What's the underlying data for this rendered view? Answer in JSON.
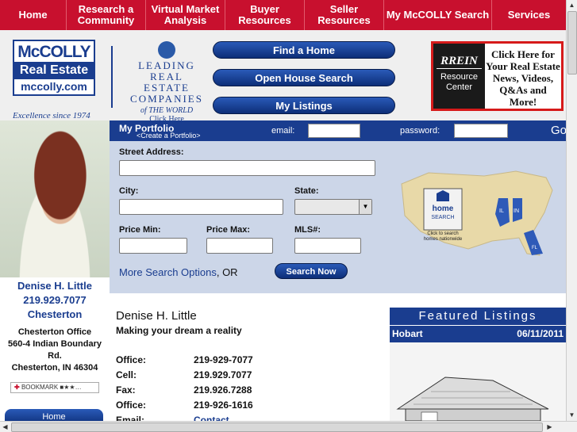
{
  "nav": {
    "home": "Home",
    "research": "Research a Community",
    "virtual": "Virtual Market Analysis",
    "buyer": "Buyer Resources",
    "seller": "Seller Resources",
    "mysearch": "My McCOLLY Search",
    "services": "Services"
  },
  "logo": {
    "brand": "McCOLLY",
    "sub": "Real Estate",
    "domain": "mccolly.com",
    "since": "Excellence since 1974"
  },
  "lrec": {
    "line1": "LEADING",
    "line2": "REAL ESTATE",
    "line3": "COMPANIES",
    "line4": "of THE WORLD",
    "click": "Click Here"
  },
  "quick": {
    "find": "Find a Home",
    "open": "Open House Search",
    "listings": "My Listings"
  },
  "rrein": {
    "logo": "RREIN",
    "sub": "Resource Center",
    "text": "Click Here for Your Real Estate News, Videos, Q&As and More!"
  },
  "portfolio": {
    "title": "My Portfolio",
    "create": "<Create a Portfolio>",
    "email_label": "email:",
    "password_label": "password:",
    "go": "Go"
  },
  "search": {
    "street_label": "Street Address:",
    "city_label": "City:",
    "state_label": "State:",
    "price_min_label": "Price Min:",
    "price_max_label": "Price Max:",
    "mls_label": "MLS#:",
    "more_options": "More Search Options",
    "or": ", OR",
    "search_now": "Search Now"
  },
  "map": {
    "badge_line1": "home",
    "badge_line2": "SEARCH",
    "caption1": "Click to search",
    "caption2": "homes nationwide",
    "state_il": "IL",
    "state_in": "IN",
    "state_fl": "FL"
  },
  "agent": {
    "name": "Denise H. Little",
    "phone": "219.929.7077",
    "city": "Chesterton",
    "office_name": "Chesterton Office",
    "office_street": "560-4 Indian Boundary Rd.",
    "office_city": "Chesterton, IN 46304",
    "bookmark": "BOOKMARK",
    "home_btn": "Home"
  },
  "details": {
    "name": "Denise H. Little",
    "tagline": "Making your dream a reality",
    "contacts": [
      {
        "label": "Office:",
        "value": "219-929-7077"
      },
      {
        "label": "Cell:",
        "value": "219.929.7077"
      },
      {
        "label": "Fax:",
        "value": "219.926.7288"
      },
      {
        "label": "Office:",
        "value": "219-926-1616"
      },
      {
        "label": "Email:",
        "value": "Contact"
      }
    ]
  },
  "featured": {
    "title": "Featured Listings",
    "city": "Hobart",
    "date": "06/11/2011"
  },
  "colors": {
    "brand_red": "#c8102e",
    "brand_blue": "#1a3d8f"
  }
}
